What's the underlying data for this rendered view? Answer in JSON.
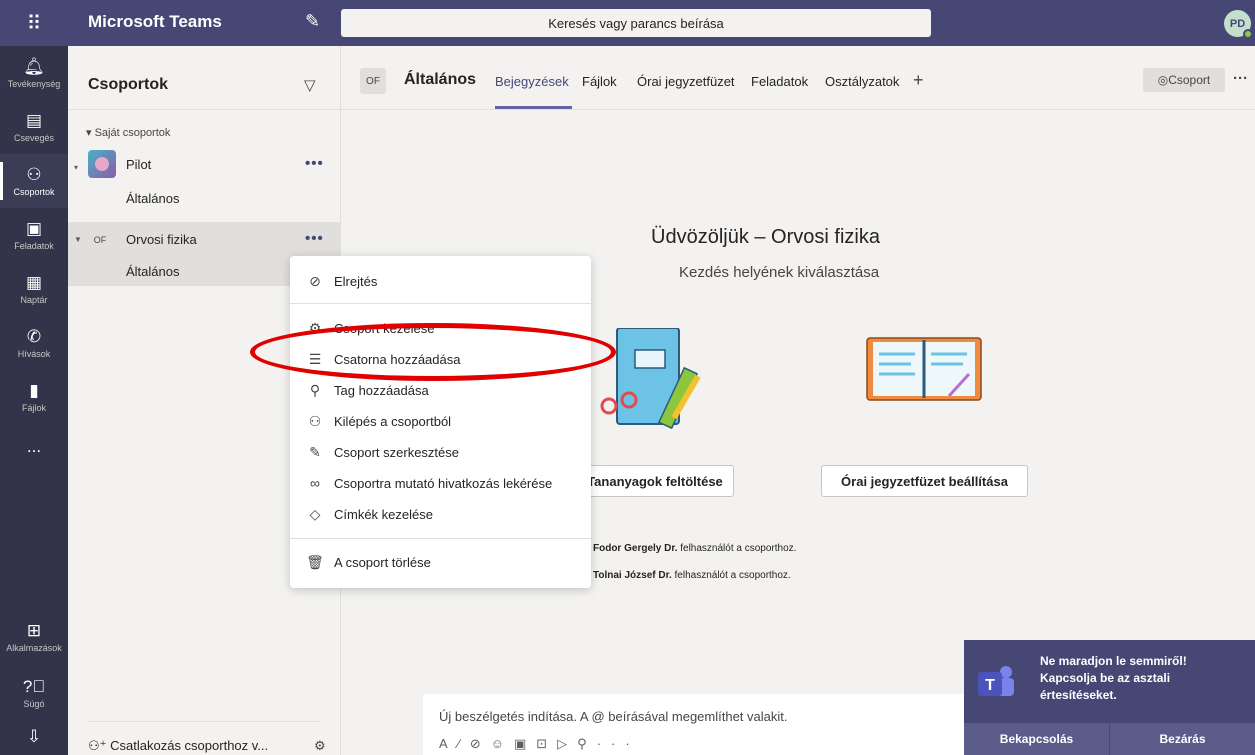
{
  "titlebar": {
    "app_title": "Microsoft Teams",
    "search_placeholder": "Keresés vagy parancs beírása",
    "avatar_initials": "PD"
  },
  "rail": {
    "items": [
      {
        "label": "Tevékenység",
        "icon": "bell-icon"
      },
      {
        "label": "Csevegés",
        "icon": "chat-icon"
      },
      {
        "label": "Csoportok",
        "icon": "teams-icon"
      },
      {
        "label": "Feladatok",
        "icon": "assignments-icon"
      },
      {
        "label": "Naptár",
        "icon": "calendar-icon"
      },
      {
        "label": "Hívások",
        "icon": "phone-icon"
      },
      {
        "label": "Fájlok",
        "icon": "files-icon"
      }
    ],
    "more": "...",
    "apps_label": "Alkalmazások",
    "help_label": "Súgó"
  },
  "teams_panel": {
    "title": "Csoportok",
    "section_label": "Saját csoportok",
    "teams": [
      {
        "name": "Pilot",
        "channel": "Általános"
      },
      {
        "name": "Orvosi fizika",
        "initials": "OF",
        "channel": "Általános"
      }
    ],
    "more": "•••",
    "join_label": "Csatlakozás csoporthoz v..."
  },
  "channel": {
    "initials": "OF",
    "title": "Általános",
    "tabs": [
      "Bejegyzések",
      "Fájlok",
      "Órai jegyzetfüzet",
      "Feladatok",
      "Osztályzatok"
    ],
    "team_button": "Csoport"
  },
  "welcome": {
    "title": "Üdvözöljük – Orvosi fizika",
    "subtitle": "Kezdés helyének kiválasztása",
    "upload_button": "Tananyagok feltöltése",
    "notebook_button": "Órai jegyzetfüzet beállítása"
  },
  "activity": [
    {
      "name": "Fodor Gergely Dr.",
      "text": "felhasználót a csoporthoz."
    },
    {
      "name": "Tolnai József Dr.",
      "text": "felhasználót a csoporthoz."
    }
  ],
  "compose": {
    "placeholder": "Új beszélgetés indítása. A @ beírásával megemlíthet valakit."
  },
  "menu": {
    "items": [
      {
        "label": "Elrejtés",
        "icon": "hide-icon"
      },
      {
        "label": "Csoport kezelése",
        "icon": "gear-icon"
      },
      {
        "label": "Csatorna hozzáadása",
        "icon": "add-channel-icon"
      },
      {
        "label": "Tag hozzáadása",
        "icon": "add-member-icon"
      },
      {
        "label": "Kilépés a csoportból",
        "icon": "leave-icon"
      },
      {
        "label": "Csoport szerkesztése",
        "icon": "pencil-icon"
      },
      {
        "label": "Csoportra mutató hivatkozás lekérése",
        "icon": "link-icon"
      },
      {
        "label": "Címkék kezelése",
        "icon": "tag-icon"
      },
      {
        "label": "A csoport törlése",
        "icon": "trash-icon"
      }
    ]
  },
  "toast": {
    "message": "Ne maradjon le semmiről! Kapcsolja be az asztali értesítéseket.",
    "enable": "Bekapcsolás",
    "close": "Bezárás"
  },
  "colors": {
    "brand": "#464775",
    "accent": "#6264a7",
    "highlight": "#e00000"
  }
}
